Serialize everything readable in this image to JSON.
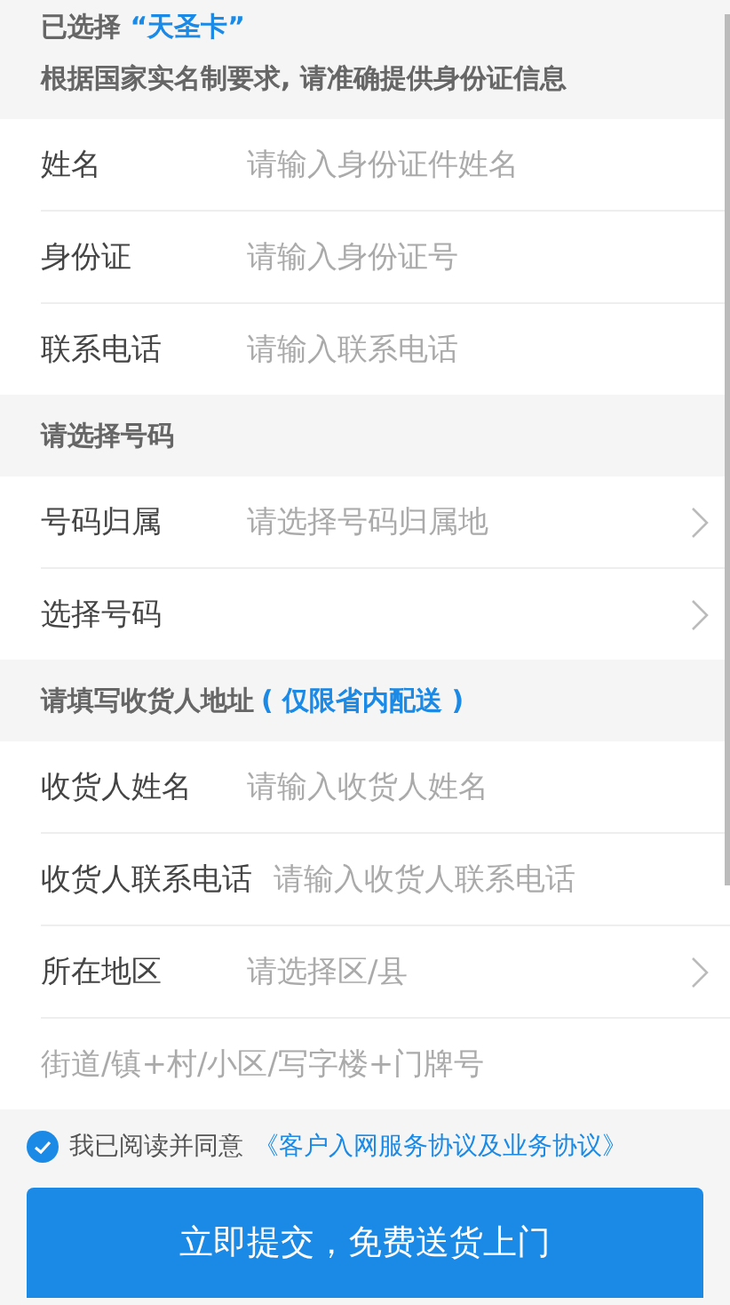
{
  "selection": {
    "prefix": "已选择",
    "card": "“天圣卡”"
  },
  "sections": [
    {
      "title": "根据国家实名制要求, 请准确提供身份证信息",
      "rows": [
        {
          "kind": "input",
          "label": "姓名",
          "placeholder": "请输入身份证件姓名"
        },
        {
          "kind": "input",
          "label": "身份证",
          "placeholder": "请输入身份证号"
        },
        {
          "kind": "input",
          "label": "联系电话",
          "placeholder": "请输入联系电话"
        }
      ]
    },
    {
      "title": "请选择号码",
      "rows": [
        {
          "kind": "select",
          "label": "号码归属",
          "placeholder": "请选择号码归属地"
        },
        {
          "kind": "select",
          "label": "选择号码"
        }
      ]
    },
    {
      "title": "请填写收货人地址",
      "note": "( 仅限省内配送 )",
      "rows": [
        {
          "kind": "input",
          "label": "收货人姓名",
          "placeholder": "请输入收货人姓名"
        },
        {
          "kind": "input",
          "label": "收货人联系电话",
          "placeholder": "请输入收货人联系电话"
        },
        {
          "kind": "select",
          "label": "所在地区",
          "placeholder": "请选择区/县"
        },
        {
          "kind": "input",
          "placeholder": "街道/镇+村/小区/写字楼+门牌号"
        }
      ]
    }
  ],
  "agreement": {
    "checked": true,
    "text": "我已阅读并同意",
    "link": "《客户入网服务协议及业务协议》"
  },
  "submit": {
    "label": "立即提交，免费送货上门"
  }
}
